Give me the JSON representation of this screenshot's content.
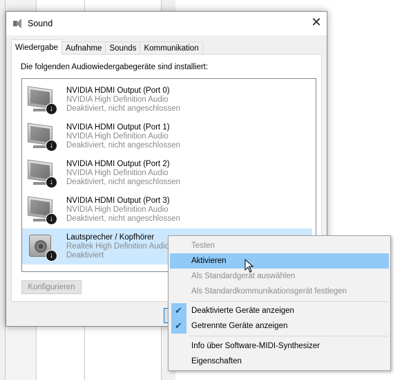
{
  "window": {
    "title": "Sound",
    "close_glyph": "✕"
  },
  "tabs": [
    {
      "label": "Wiedergabe",
      "active": true
    },
    {
      "label": "Aufnahme",
      "active": false
    },
    {
      "label": "Sounds",
      "active": false
    },
    {
      "label": "Kommunikation",
      "active": false
    }
  ],
  "panel": {
    "heading": "Die folgenden Audiowiedergabegeräte sind installiert:"
  },
  "devices": [
    {
      "name": "NVIDIA HDMI Output (Port 0)",
      "driver": "NVIDIA High Definition Audio",
      "status": "Deaktiviert, nicht angeschlossen",
      "icon": "monitor-icon",
      "selected": false
    },
    {
      "name": "NVIDIA HDMI Output (Port 1)",
      "driver": "NVIDIA High Definition Audio",
      "status": "Deaktiviert, nicht angeschlossen",
      "icon": "monitor-icon",
      "selected": false
    },
    {
      "name": "NVIDIA HDMI Output (Port 2)",
      "driver": "NVIDIA High Definition Audio",
      "status": "Deaktiviert, nicht angeschlossen",
      "icon": "monitor-icon",
      "selected": false
    },
    {
      "name": "NVIDIA HDMI Output (Port 3)",
      "driver": "NVIDIA High Definition Audio",
      "status": "Deaktiviert, nicht angeschlossen",
      "icon": "monitor-icon",
      "selected": false
    },
    {
      "name": "Lautsprecher / Kopfhörer",
      "driver": "Realtek High Definition Audio",
      "status": "Deaktiviert",
      "icon": "speaker-icon",
      "selected": true
    }
  ],
  "buttons": {
    "configure": "Konfigurieren"
  },
  "context_menu": {
    "items": [
      {
        "label": "Testen",
        "disabled": true,
        "hover": false,
        "checked": false
      },
      {
        "label": "Aktivieren",
        "disabled": false,
        "hover": true,
        "checked": false
      },
      {
        "label": "Als Standardgerät auswählen",
        "disabled": true,
        "hover": false,
        "checked": false
      },
      {
        "label": "Als Standardkommunikationsgerät festlegen",
        "disabled": true,
        "hover": false,
        "checked": false
      },
      {
        "label": "Deaktivierte Geräte anzeigen",
        "disabled": false,
        "hover": false,
        "checked": true
      },
      {
        "label": "Getrennte Geräte anzeigen",
        "disabled": false,
        "hover": false,
        "checked": true
      },
      {
        "label": "Info über Software-MIDI-Synthesizer",
        "disabled": false,
        "hover": false,
        "checked": false
      },
      {
        "label": "Eigenschaften",
        "disabled": false,
        "hover": false,
        "checked": false
      }
    ]
  },
  "colors": {
    "selection": "#cce8ff",
    "menu_hover": "#91c9f7",
    "disabled_text": "#8d8d8d"
  }
}
